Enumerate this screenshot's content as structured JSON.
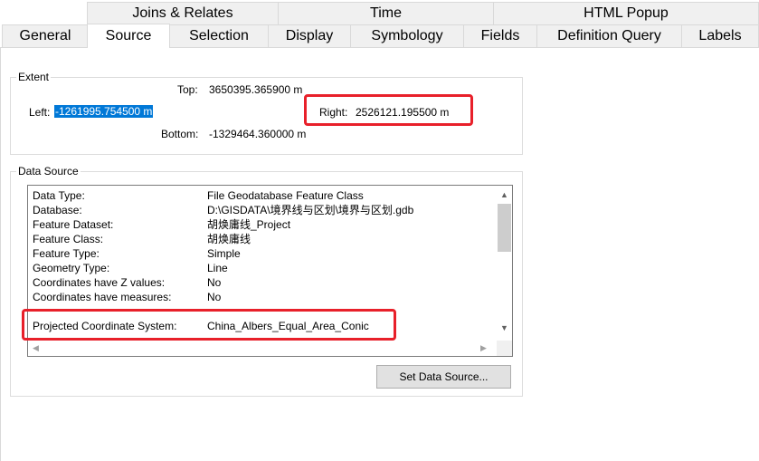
{
  "tabs": {
    "row1": [
      {
        "label": "Joins & Relates"
      },
      {
        "label": "Time"
      },
      {
        "label": "HTML Popup"
      }
    ],
    "row2": [
      {
        "label": "General"
      },
      {
        "label": "Source",
        "active": true
      },
      {
        "label": "Selection"
      },
      {
        "label": "Display"
      },
      {
        "label": "Symbology"
      },
      {
        "label": "Fields"
      },
      {
        "label": "Definition Query"
      },
      {
        "label": "Labels"
      }
    ]
  },
  "extent": {
    "legend": "Extent",
    "top_label": "Top:",
    "top_value": "3650395.365900 m",
    "left_label": "Left:",
    "left_value": "-1261995.754500 m",
    "right_label": "Right:",
    "right_value": "2526121.195500 m",
    "bottom_label": "Bottom:",
    "bottom_value": "-1329464.360000 m"
  },
  "data_source": {
    "legend": "Data Source",
    "rows": [
      {
        "key": "Data Type:",
        "value": "File Geodatabase Feature Class"
      },
      {
        "key": "Database:",
        "value": "D:\\GISDATA\\境界线与区划\\境界与区划.gdb"
      },
      {
        "key": "Feature Dataset:",
        "value": "胡焕庸线_Project"
      },
      {
        "key": "Feature Class:",
        "value": "胡焕庸线"
      },
      {
        "key": "Feature Type:",
        "value": "Simple"
      },
      {
        "key": "Geometry Type:",
        "value": "Line"
      },
      {
        "key": "Coordinates have Z values:",
        "value": "No"
      },
      {
        "key": "Coordinates have measures:",
        "value": "No"
      },
      {
        "key": "Projected Coordinate System:",
        "value": "China_Albers_Equal_Area_Conic"
      }
    ],
    "set_source_button": "Set Data Source..."
  },
  "icons": {
    "scroll_up": "▲",
    "scroll_down": "▼",
    "scroll_left": "◀",
    "scroll_right": "▶"
  },
  "colors": {
    "selection": "#0078d7",
    "highlight": "#e8202a"
  }
}
